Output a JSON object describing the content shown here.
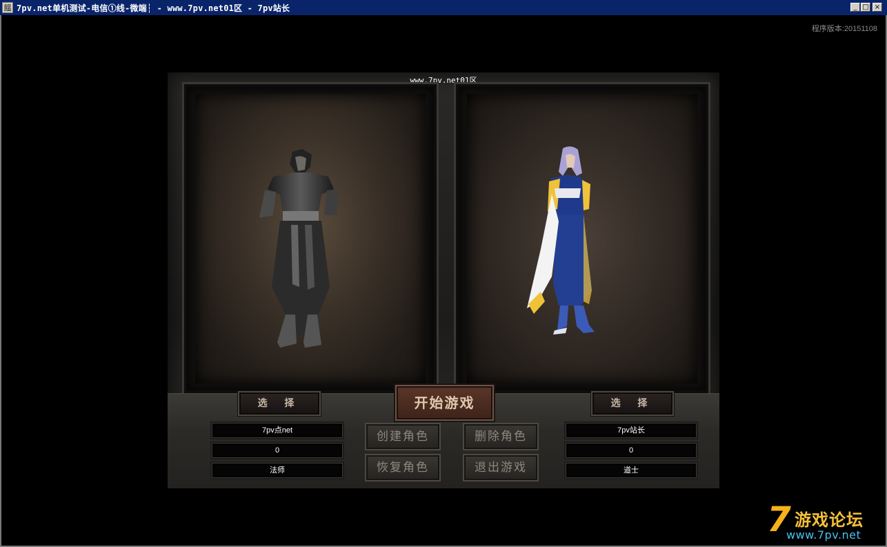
{
  "window": {
    "icon_glyph": "饂",
    "title": "7pv.net单机测试-电信①线-微端┆ - www.7pv.net01区 - 7pv站长",
    "minimize": "_",
    "maximize": "□",
    "close": "×"
  },
  "version_label": "程序版本:20151108",
  "server_name": "www.7pv.net01区",
  "left_character": {
    "select_label": "选 择",
    "name": "7pv点net",
    "level": "0",
    "class": "法师"
  },
  "right_character": {
    "select_label": "选 择",
    "name": "7pv站长",
    "level": "0",
    "class": "道士"
  },
  "buttons": {
    "start": "开始游戏",
    "create": "创建角色",
    "delete": "删除角色",
    "restore": "恢复角色",
    "exit": "退出游戏"
  },
  "watermark": {
    "seven": "7",
    "text": "游戏论坛",
    "url": "www.7pv.net"
  },
  "colors": {
    "titlebar": "#0a246a",
    "start_button": "#5a3628",
    "watermark_gold": "#f6c03a",
    "watermark_blue": "#49c1ee"
  },
  "icons": [
    "app-icon",
    "minimize-icon",
    "maximize-icon",
    "close-icon"
  ]
}
